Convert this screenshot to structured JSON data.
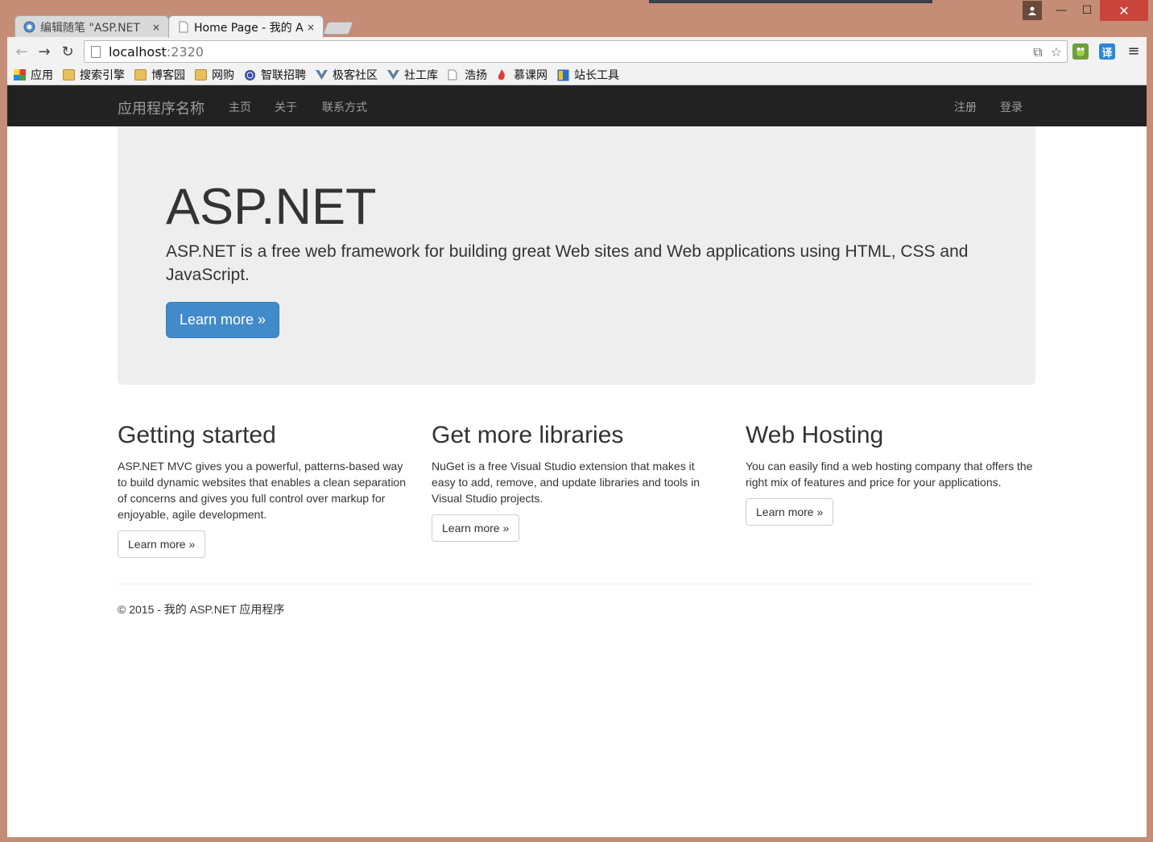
{
  "tabs": [
    {
      "title": "编辑随笔 \"ASP.NET",
      "close": "×"
    },
    {
      "title": "Home Page - 我的 A",
      "close": "×"
    }
  ],
  "window": {
    "minimize": "—",
    "maximize": "☐",
    "close": "✕"
  },
  "toolbar": {
    "back": "←",
    "forward": "→",
    "reload": "↻",
    "url_host": "localhost",
    "url_port": ":2320",
    "translate_icon": "⧉",
    "star": "☆",
    "ext_translate_label": "译",
    "menu": "≡"
  },
  "bookmarks": [
    {
      "label": "应用",
      "icon": "apps-grid-icon"
    },
    {
      "label": "搜索引擎",
      "icon": "folder-icon"
    },
    {
      "label": "博客园",
      "icon": "folder-icon"
    },
    {
      "label": "网购",
      "icon": "folder-icon"
    },
    {
      "label": "智联招聘",
      "icon": "globe-icon"
    },
    {
      "label": "极客社区",
      "icon": "vue-icon"
    },
    {
      "label": "社工库",
      "icon": "vue-icon"
    },
    {
      "label": "浩扬",
      "icon": "page-icon"
    },
    {
      "label": "慕课网",
      "icon": "flame-icon"
    },
    {
      "label": "站长工具",
      "icon": "tool-icon"
    }
  ],
  "navbar": {
    "brand": "应用程序名称",
    "links": [
      "主页",
      "关于",
      "联系方式"
    ],
    "right_links": [
      "注册",
      "登录"
    ]
  },
  "jumbotron": {
    "title": "ASP.NET",
    "lead": "ASP.NET is a free web framework for building great Web sites and Web applications using HTML, CSS and JavaScript.",
    "button": "Learn more »"
  },
  "columns": [
    {
      "heading": "Getting started",
      "text": "ASP.NET MVC gives you a powerful, patterns-based way to build dynamic websites that enables a clean separation of concerns and gives you full control over markup for enjoyable, agile development.",
      "button": "Learn more »"
    },
    {
      "heading": "Get more libraries",
      "text": "NuGet is a free Visual Studio extension that makes it easy to add, remove, and update libraries and tools in Visual Studio projects.",
      "button": "Learn more »"
    },
    {
      "heading": "Web Hosting",
      "text": "You can easily find a web hosting company that offers the right mix of features and price for your applications.",
      "button": "Learn more »"
    }
  ],
  "footer": "© 2015 - 我的 ASP.NET 应用程序",
  "colors": {
    "navbar": "#222222",
    "jumbotron": "#eeeeee",
    "primary": "#428bca",
    "frame": "#c58c76"
  }
}
